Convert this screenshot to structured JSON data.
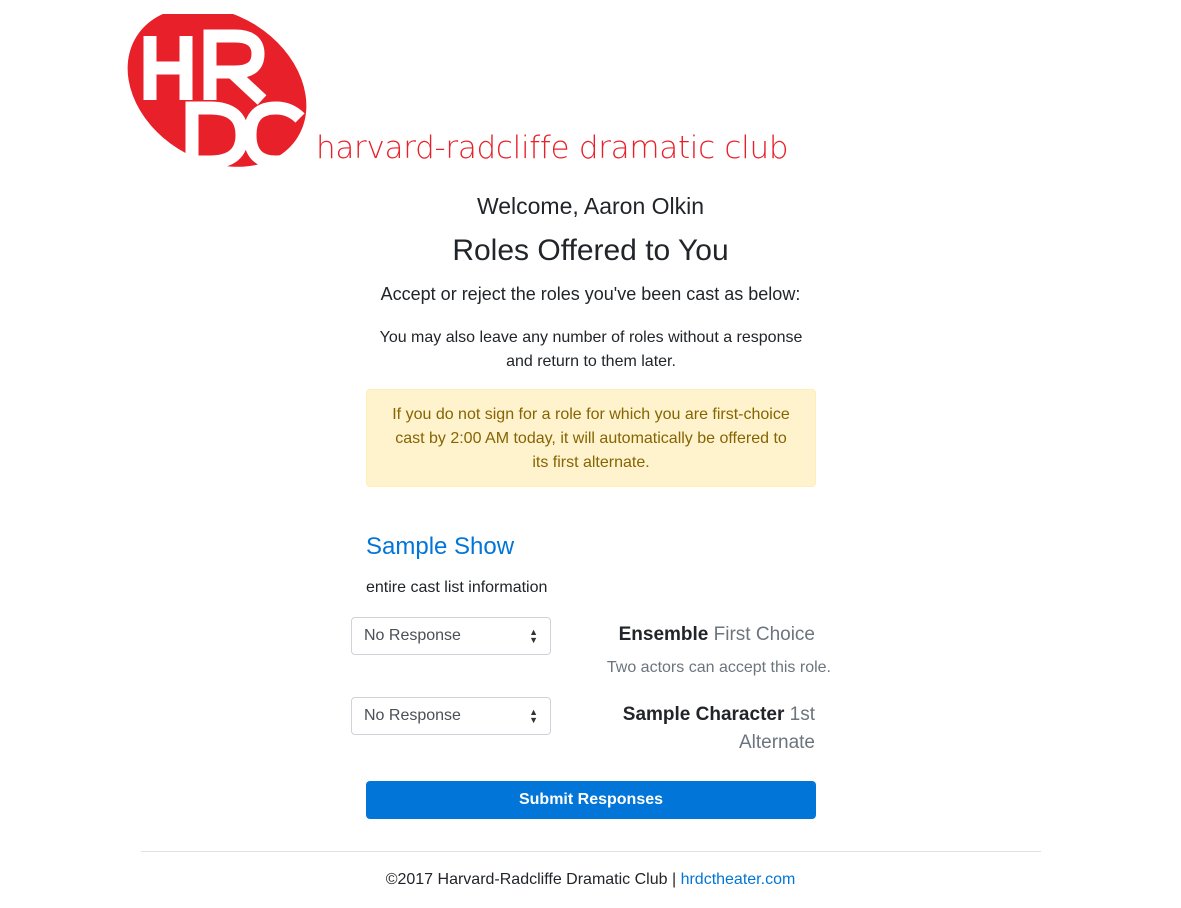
{
  "brand": {
    "logo_letters": "HRDC",
    "club_name": "harvard-radcliffe dramatic club",
    "color": "#e8202a"
  },
  "header": {
    "welcome": "Welcome, Aaron Olkin",
    "title": "Roles Offered to You",
    "instructions": "Accept or reject the roles you've been cast as below:",
    "note": "You may also leave any number of roles without a response and return to them later."
  },
  "alert": {
    "text": "If you do not sign for a role for which you are first-choice cast by 2:00 AM today, it will automatically be offered to its first alternate.",
    "background": "#fff3cd",
    "color": "#856404"
  },
  "show": {
    "title": "Sample Show",
    "cast_info": "entire cast list information",
    "roles": [
      {
        "response": "No Response",
        "name": "Ensemble",
        "choice": "First Choice",
        "note": "Two actors can accept this role."
      },
      {
        "response": "No Response",
        "name": "Sample Character",
        "choice": "1st Alternate"
      }
    ]
  },
  "submit_label": "Submit Responses",
  "footer": {
    "copyright": "©2017 Harvard-Radcliffe Dramatic Club",
    "separator": " | ",
    "link_text": "hrdctheater.com"
  },
  "accent_color": "#0275d8"
}
